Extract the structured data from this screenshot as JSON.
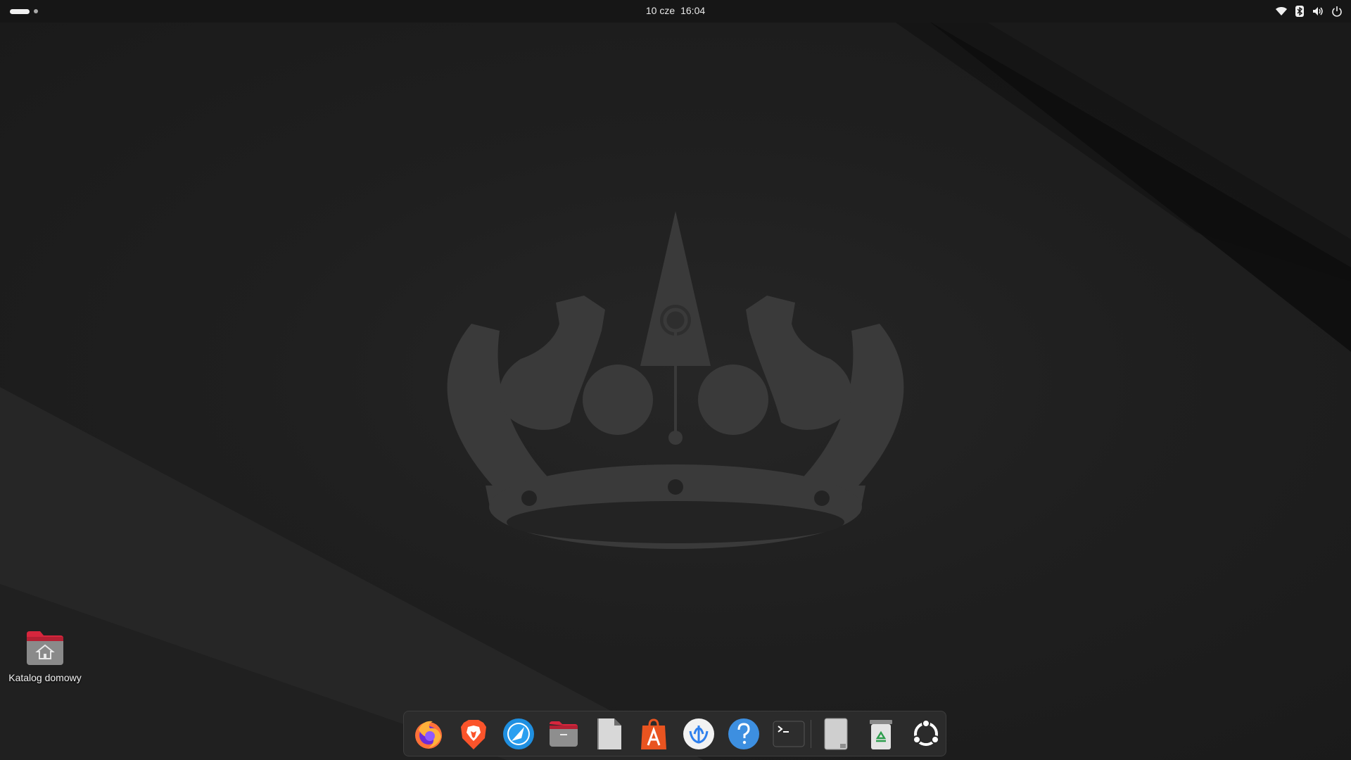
{
  "topbar": {
    "date": "10 cze",
    "time": "16:04"
  },
  "tray_icons": [
    "wifi-icon",
    "bluetooth-icon",
    "volume-icon",
    "power-icon"
  ],
  "desktop": {
    "icons": [
      {
        "label": "Katalog domowy",
        "icon": "home-folder-icon"
      }
    ]
  },
  "dock": {
    "apps": [
      {
        "icon": "firefox-icon"
      },
      {
        "icon": "brave-icon"
      },
      {
        "icon": "thunderbird-icon"
      },
      {
        "icon": "files-icon"
      },
      {
        "icon": "text-editor-icon"
      },
      {
        "icon": "app-center-icon"
      },
      {
        "icon": "vscodium-icon"
      },
      {
        "icon": "help-icon"
      },
      {
        "icon": "terminal-icon"
      }
    ],
    "pinned_after_separator": [
      {
        "icon": "ssd-drive-icon"
      },
      {
        "icon": "trash-icon"
      },
      {
        "icon": "show-apps-icon"
      }
    ]
  },
  "colors": {
    "topbar_bg": "#161616",
    "desktop_bg": "#1d1d1d",
    "crown": "#3a3a3a",
    "dock_bg": "#2b2b2b",
    "folder": "#d7263d"
  }
}
